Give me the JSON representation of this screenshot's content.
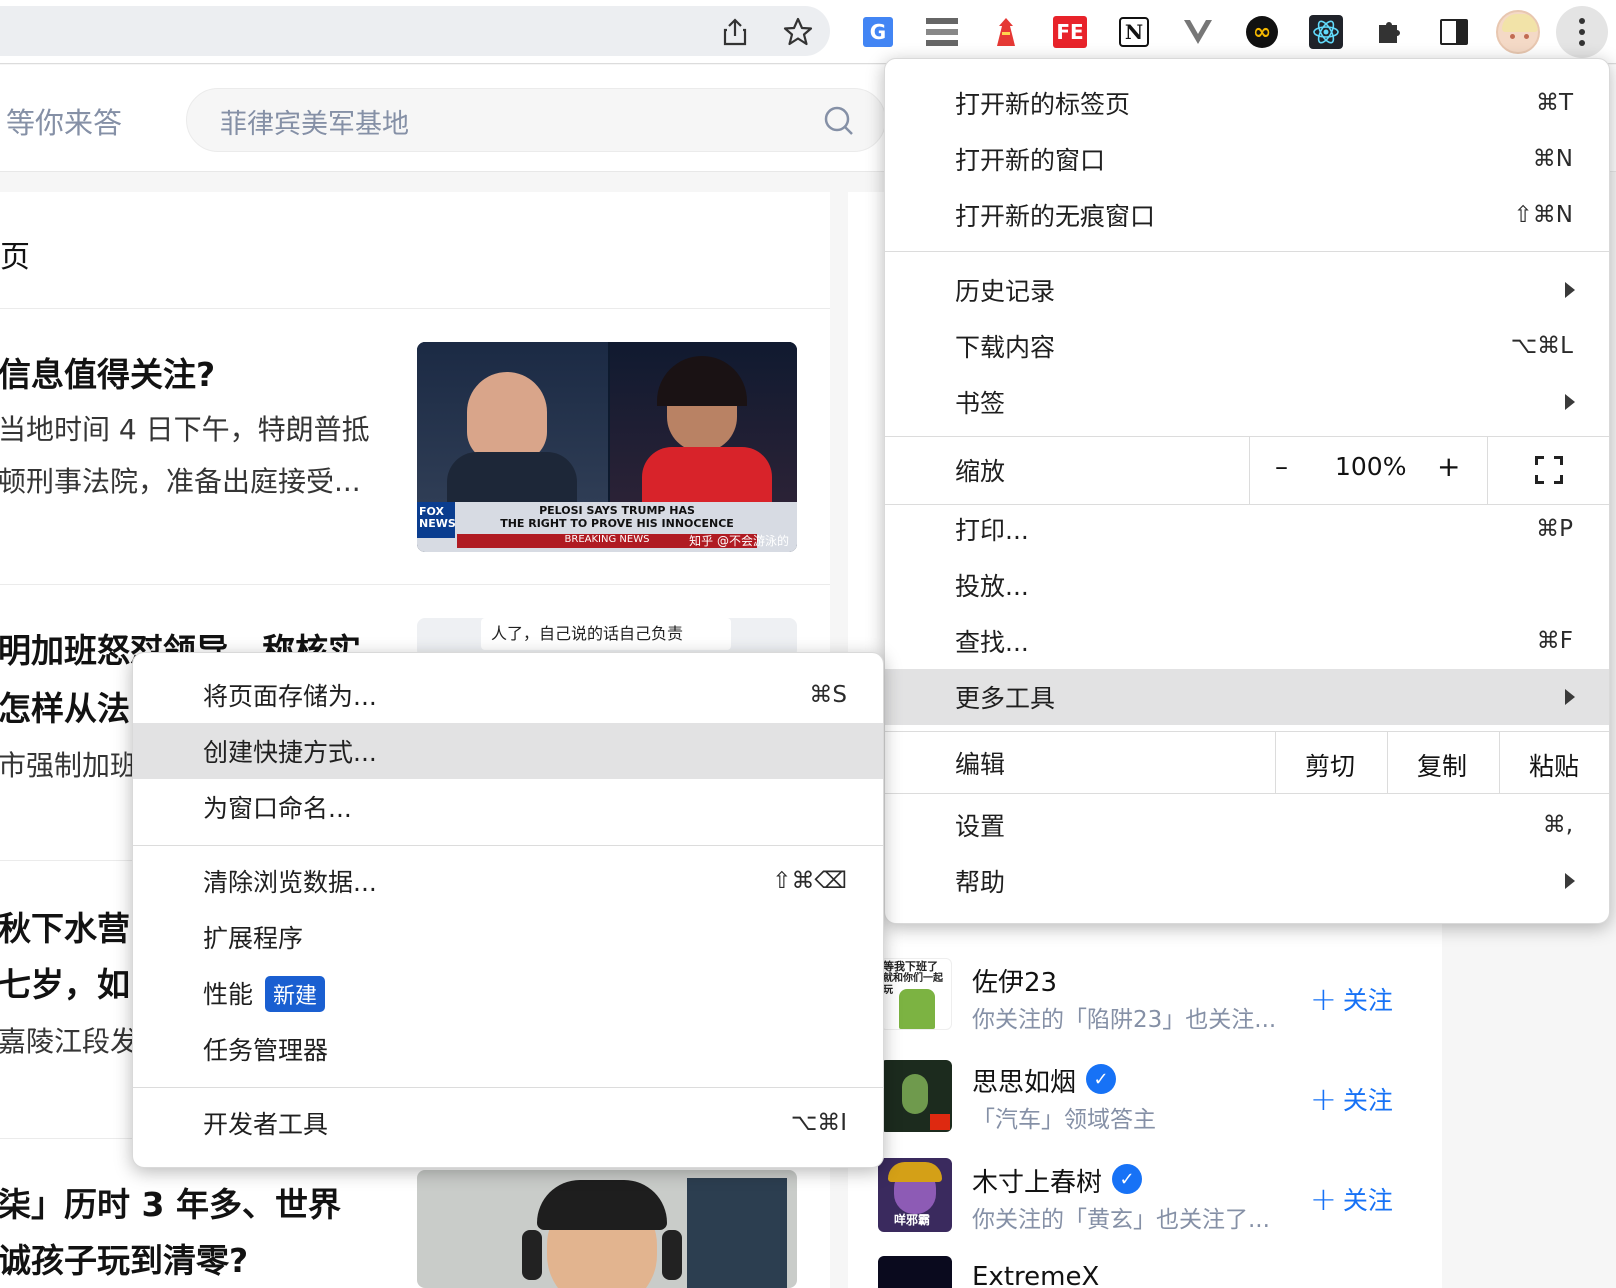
{
  "toolbar": {
    "icons": [
      "share-icon",
      "bookmark-star-icon",
      "google-translate-icon",
      "extension-list-icon",
      "extension-red-icon",
      "extension-fe-icon",
      "notion-icon",
      "vue-icon",
      "infinity-icon",
      "react-devtools-icon",
      "puzzle-icon",
      "side-panel-icon",
      "profile-avatar",
      "more-menu-icon"
    ],
    "ext_labels": {
      "notion": "N",
      "fe": "FE"
    }
  },
  "header": {
    "link": "等你来答",
    "search_value": "菲律宾美军基地"
  },
  "feed": {
    "head_fragment": "页",
    "items": [
      {
        "title": "信息值得关注?",
        "excerpt": [
          "当地时间 4 日下午，特朗普抵",
          "顿刑事法院，准备出庭接受..."
        ],
        "thumb_caption": [
          "PELOSI SAYS TRUMP HAS",
          "THE RIGHT TO PROVE HIS INNOCENCE"
        ],
        "thumb_banner": "BREAKING NEWS",
        "thumb_brand": "FOX NEWS",
        "watermark": "知乎 @不会游泳的"
      },
      {
        "title": "明加班怒怼领导，称核实",
        "title2": "怎样从法",
        "excerpt": [
          "市强制加班"
        ],
        "thumb_caption": [
          "人了，自己说的话自己负责"
        ]
      },
      {
        "title": "秋下水营",
        "title2": "七岁，如",
        "excerpt": [
          "嘉陵江段发"
        ]
      },
      {
        "title": "柒」历时 3 年多、世界",
        "title2": "诚孩子玩到清零?"
      }
    ]
  },
  "recommendations": [
    {
      "name": "佐伊23",
      "desc": "你关注的「陷阱23」也关注...",
      "follow": "关注",
      "avatar_text": [
        "等我下班了",
        "就和你们一起玩"
      ],
      "verified": false
    },
    {
      "name": "思思如烟",
      "desc": "「汽车」领域答主",
      "follow": "关注",
      "verified": true
    },
    {
      "name": "木寸上春树",
      "desc": "你关注的「黄玄」也关注了...",
      "follow": "关注",
      "avatar_text": [
        "咩邪霸"
      ],
      "verified": true
    },
    {
      "name": "ExtremeX",
      "desc": "",
      "follow": "关注",
      "verified": false
    }
  ],
  "main_menu": {
    "new_tab": {
      "label": "打开新的标签页",
      "shortcut": "⌘T"
    },
    "new_window": {
      "label": "打开新的窗口",
      "shortcut": "⌘N"
    },
    "incognito": {
      "label": "打开新的无痕窗口",
      "shortcut": "⇧⌘N"
    },
    "history": {
      "label": "历史记录"
    },
    "downloads": {
      "label": "下载内容",
      "shortcut": "⌥⌘L"
    },
    "bookmarks": {
      "label": "书签"
    },
    "zoom": {
      "label": "缩放",
      "minus": "–",
      "value": "100%",
      "plus": "+"
    },
    "print": {
      "label": "打印...",
      "shortcut": "⌘P"
    },
    "cast": {
      "label": "投放..."
    },
    "find": {
      "label": "查找...",
      "shortcut": "⌘F"
    },
    "more_tools": {
      "label": "更多工具"
    },
    "edit": {
      "label": "编辑",
      "cut": "剪切",
      "copy": "复制",
      "paste": "粘贴"
    },
    "settings": {
      "label": "设置",
      "shortcut": "⌘,"
    },
    "help": {
      "label": "帮助"
    }
  },
  "submenu": {
    "save_page": {
      "label": "将页面存储为...",
      "shortcut": "⌘S"
    },
    "create_shortcut": {
      "label": "创建快捷方式..."
    },
    "name_window": {
      "label": "为窗口命名..."
    },
    "clear_data": {
      "label": "清除浏览数据...",
      "shortcut": "⇧⌘⌫"
    },
    "extensions": {
      "label": "扩展程序"
    },
    "performance": {
      "label": "性能",
      "badge": "新建"
    },
    "task_manager": {
      "label": "任务管理器"
    },
    "devtools": {
      "label": "开发者工具",
      "shortcut": "⌥⌘I"
    }
  },
  "colors": {
    "accent": "#1772f6",
    "highlight": "#e2e2e3",
    "badge": "#1a5fd1"
  }
}
